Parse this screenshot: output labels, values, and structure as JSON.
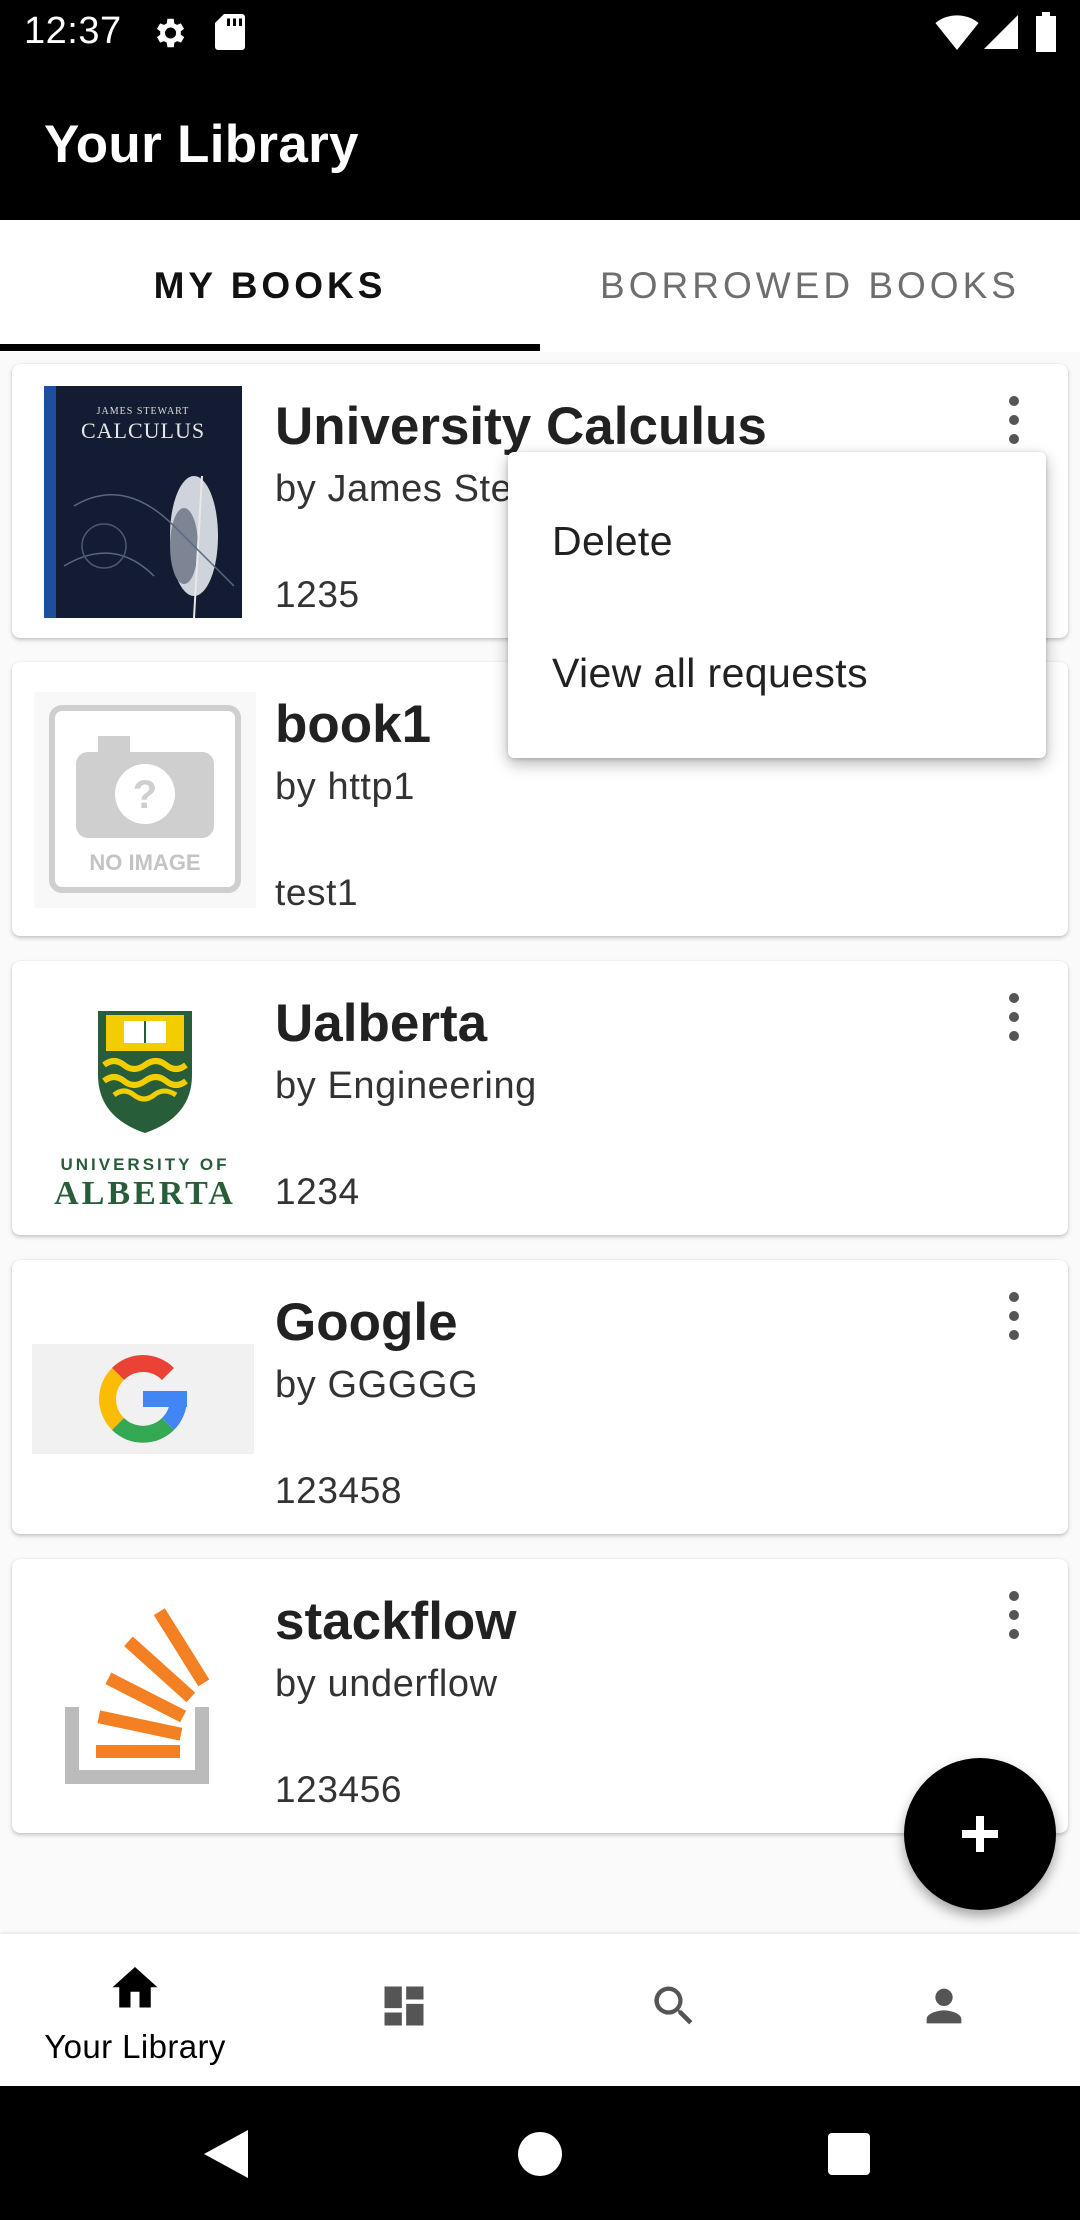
{
  "status_bar": {
    "time": "12:37",
    "icons": [
      "settings-icon",
      "sd-card-icon",
      "wifi-icon",
      "signal-icon",
      "battery-icon"
    ]
  },
  "app_bar": {
    "title": "Your Library"
  },
  "tabs": [
    {
      "label": "MY BOOKS",
      "active": true
    },
    {
      "label": "BORROWED BOOKS",
      "active": false
    }
  ],
  "books": [
    {
      "title": "University Calculus",
      "author": "by James Stewart",
      "isbn": "1235",
      "cover": {
        "publisher_line": "JAMES STEWART",
        "title": "CALCULUS"
      }
    },
    {
      "title": "book1",
      "author": "by http1",
      "isbn": "test1",
      "cover": {
        "placeholder_text": "NO IMAGE"
      }
    },
    {
      "title": "Ualberta",
      "author": "by Engineering",
      "isbn": "1234",
      "cover": {
        "line1": "UNIVERSITY OF",
        "line2": "ALBERTA"
      }
    },
    {
      "title": "Google",
      "author": "by GGGGG",
      "isbn": "123458"
    },
    {
      "title": "stackflow",
      "author": "by underflow",
      "isbn": "123456"
    }
  ],
  "popup_menu": {
    "items": [
      "Delete",
      "View all requests"
    ]
  },
  "fab": {
    "icon": "plus-icon"
  },
  "bottom_nav": [
    {
      "label": "Your Library",
      "icon": "home-icon",
      "active": true
    },
    {
      "label": "",
      "icon": "dashboard-icon"
    },
    {
      "label": "",
      "icon": "search-icon"
    },
    {
      "label": "",
      "icon": "person-icon"
    }
  ],
  "system_nav": [
    "back-icon",
    "home-circle-icon",
    "recents-icon"
  ],
  "colors": {
    "bars": "#000000",
    "background": "#fafafa",
    "card": "#ffffff",
    "google_blue": "#4285F4",
    "so_orange": "#F48024",
    "ua_green": "#275D38",
    "ua_gold": "#F2CD00"
  }
}
